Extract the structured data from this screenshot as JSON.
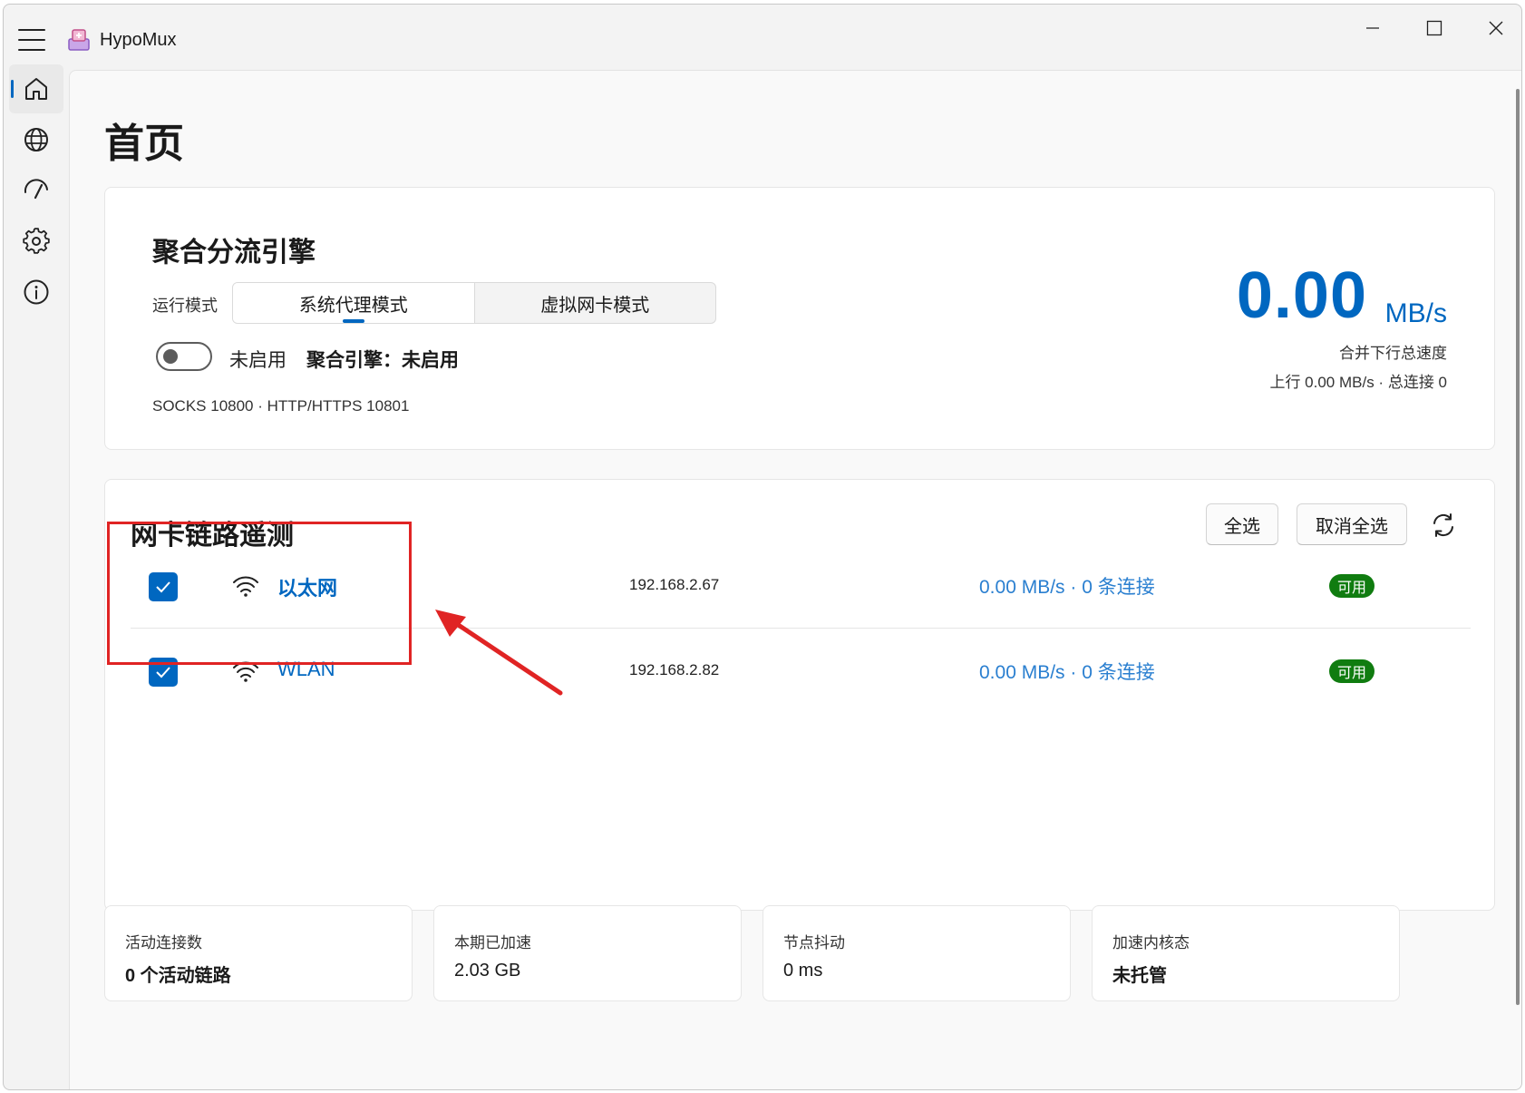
{
  "app": {
    "title": "HypoMux"
  },
  "nav": {
    "items": [
      {
        "name": "home",
        "icon": "home-icon"
      },
      {
        "name": "globe",
        "icon": "globe-icon"
      },
      {
        "name": "speedometer",
        "icon": "speedometer-icon"
      },
      {
        "name": "settings",
        "icon": "gear-icon"
      },
      {
        "name": "about",
        "icon": "info-icon"
      }
    ]
  },
  "page": {
    "title": "首页"
  },
  "engine": {
    "title": "聚合分流引擎",
    "mode_label": "运行模式",
    "modes": [
      {
        "label": "系统代理模式",
        "selected": true
      },
      {
        "label": "虚拟网卡模式",
        "selected": false
      }
    ],
    "toggle_on": false,
    "toggle_state": "未启用",
    "status": "聚合引擎：未启用",
    "ports": "SOCKS 10800 · HTTP/HTTPS 10801",
    "speed_value": "0.00",
    "speed_unit": "MB/s",
    "speed_label": "合并下行总速度",
    "speed_sub": "上行 0.00 MB/s · 总连接 0",
    "accent_color": "#0067c0"
  },
  "telemetry": {
    "title": "网卡链路遥测",
    "select_all": "全选",
    "deselect_all": "取消全选",
    "adapters": [
      {
        "checked": true,
        "name": "以太网",
        "ip": "192.168.2.67",
        "rate": "0.00 MB/s · 0 条连接",
        "status": "可用"
      },
      {
        "checked": true,
        "name": "WLAN",
        "ip": "192.168.2.82",
        "rate": "0.00 MB/s · 0 条连接",
        "status": "可用"
      }
    ],
    "status_color": "#107c10"
  },
  "stats": [
    {
      "label": "活动连接数",
      "value": "0 个活动链路"
    },
    {
      "label": "本期已加速",
      "value": "2.03 GB"
    },
    {
      "label": "节点抖动",
      "value": "0 ms"
    },
    {
      "label": "加速内核态",
      "value": "未托管"
    }
  ]
}
